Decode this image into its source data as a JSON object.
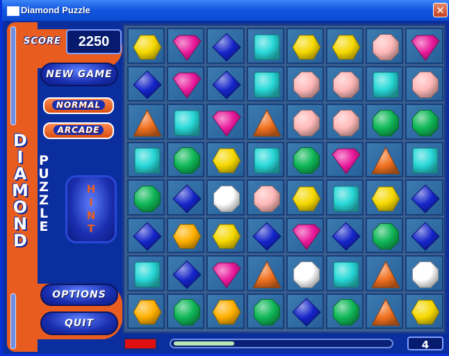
{
  "window": {
    "title": "Diamond Puzzle"
  },
  "panel": {
    "score_label": "SCORE",
    "score_value": "2250",
    "new_game_label": "NEW GAME",
    "normal_label": "NORMAL",
    "arcade_label": "ARCADE",
    "logo_word1": [
      "D",
      "I",
      "A",
      "M",
      "O",
      "N",
      "D"
    ],
    "logo_word2": [
      "P",
      "U",
      "Z",
      "Z",
      "L",
      "E"
    ],
    "hint_label": "HINT",
    "options_label": "OPTIONS",
    "quit_label": "QUIT"
  },
  "status": {
    "level": "4",
    "time_fraction": 0.28
  },
  "colors": {
    "yellow": "#f5d800",
    "magenta": "#e8189a",
    "blue": "#1424c8",
    "cyan": "#28d8d8",
    "pink": "#ffb8b8",
    "orange": "#f07020",
    "green": "#10b858",
    "white": "#ffffff",
    "gold": "#ffb000"
  },
  "board": {
    "rows": 8,
    "cols": 8,
    "grid": [
      [
        "yellow-hex",
        "magenta-gem",
        "blue-diamond",
        "cyan-square",
        "yellow-hex",
        "yellow-hex",
        "pink-octagon",
        "magenta-gem"
      ],
      [
        "blue-diamond",
        "magenta-gem",
        "blue-diamond",
        "cyan-square",
        "pink-octagon",
        "pink-octagon",
        "cyan-square",
        "pink-octagon"
      ],
      [
        "orange-triangle",
        "cyan-square",
        "magenta-gem",
        "orange-triangle",
        "pink-octagon",
        "pink-octagon",
        "green-octagon",
        "green-octagon"
      ],
      [
        "cyan-square",
        "green-octagon",
        "yellow-hex",
        "cyan-square",
        "green-octagon",
        "magenta-gem",
        "orange-triangle",
        "cyan-square"
      ],
      [
        "green-octagon",
        "blue-diamond",
        "white-octagon",
        "pink-octagon",
        "yellow-hex",
        "cyan-square",
        "yellow-hex",
        "blue-diamond"
      ],
      [
        "blue-diamond",
        "gold-hex",
        "yellow-hex",
        "blue-diamond",
        "magenta-gem",
        "blue-diamond",
        "green-octagon",
        "blue-diamond"
      ],
      [
        "cyan-square",
        "blue-diamond",
        "magenta-gem",
        "orange-triangle",
        "white-octagon",
        "cyan-square",
        "orange-triangle",
        "white-octagon"
      ],
      [
        "gold-hex",
        "green-octagon",
        "gold-hex",
        "green-octagon",
        "blue-diamond",
        "green-octagon",
        "orange-triangle",
        "yellow-hex"
      ]
    ]
  }
}
